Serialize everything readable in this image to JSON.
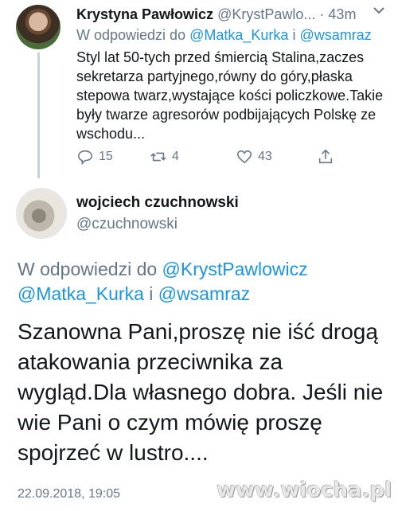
{
  "tweet1": {
    "author_name": "Krystyna Pawłowicz",
    "author_handle": "@KrystPawlo...",
    "time": "· 43m",
    "reply_prefix": "W odpowiedzi do",
    "reply_mention_1": "@Matka_Kurka",
    "reply_joiner": "i",
    "reply_mention_2": "@wsamraz",
    "text": "Styl lat 50-tych przed śmiercią Stalina,zaczes sekretarza partyjnego,równy do góry,płaska stepowa twarz,wystające kości policzkowe.Takie były twarze agresorów podbijających Polskę ze wschodu...",
    "replies": "15",
    "retweets": "4",
    "likes": "43"
  },
  "tweet2": {
    "author_name": "wojciech czuchnowski",
    "author_handle": "@czuchnowski",
    "reply_prefix": "W odpowiedzi do",
    "reply_mention_1": "@KrystPawlowicz",
    "reply_mention_2": "@Matka_Kurka",
    "reply_joiner": "i",
    "reply_mention_3": "@wsamraz",
    "text": "Szanowna Pani,proszę nie iść drogą atakowania przeciwnika za wygląd.Dla własnego dobra. Jeśli nie wie Pani o czym mówię proszę spojrzeć w lustro....",
    "timestamp": "22.09.2018, 19:05"
  },
  "watermark": "www.wiocha.pl",
  "colors": {
    "link": "#1b95e0",
    "muted": "#657786",
    "text": "#14171a"
  },
  "icons": [
    "more-icon",
    "reply-icon",
    "retweet-icon",
    "like-icon",
    "share-icon"
  ]
}
